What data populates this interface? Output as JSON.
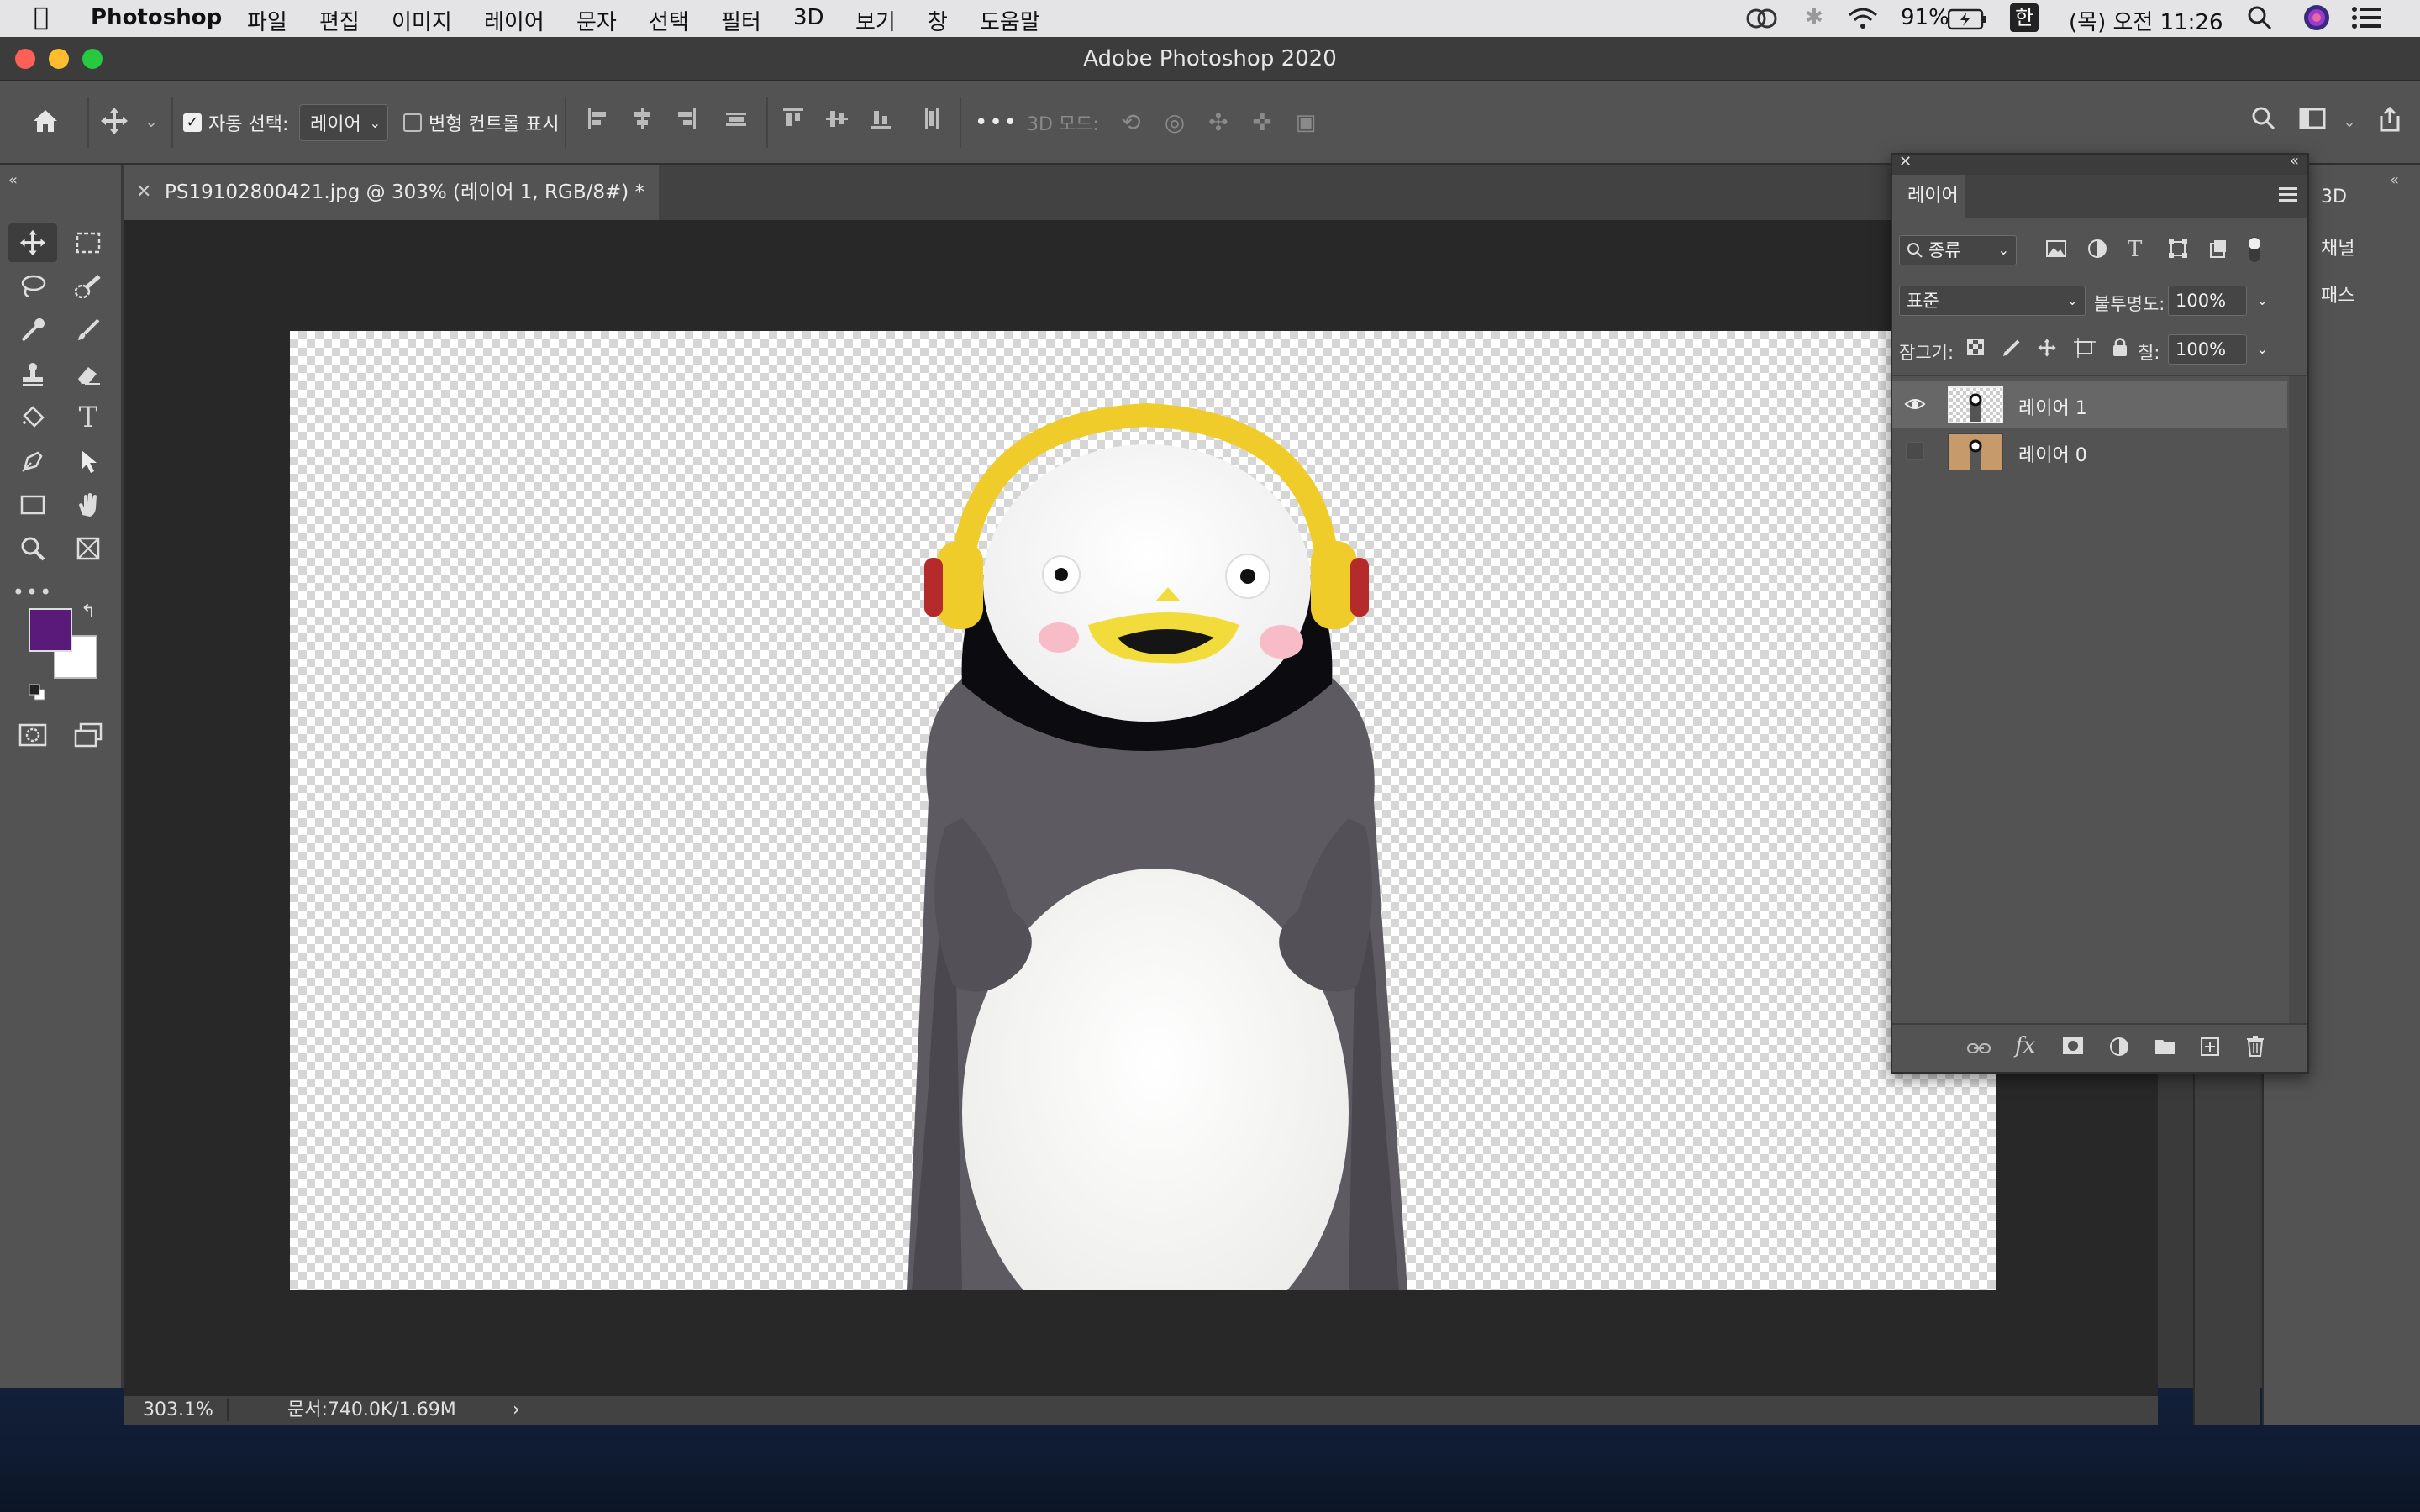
{
  "menubar": {
    "app_name": "Photoshop",
    "items": [
      "파일",
      "편집",
      "이미지",
      "레이어",
      "문자",
      "선택",
      "필터",
      "3D",
      "보기",
      "창",
      "도움말"
    ],
    "battery": "91%",
    "input_source": "한",
    "clock": "(목) 오전 11:26"
  },
  "window": {
    "title": "Adobe Photoshop 2020"
  },
  "options_bar": {
    "auto_select_label": "자동 선택:",
    "auto_select_checked": true,
    "auto_select_target": "레이어",
    "transform_controls_label": "변형 컨트롤 표시",
    "transform_controls_checked": false,
    "more": "•••",
    "mode_3d_label": "3D 모드:"
  },
  "document": {
    "tab_title": "PS19102800421.jpg @ 303% (레이어 1, RGB/8#) *",
    "zoom": "303.1%",
    "doc_info": "문서:740.0K/1.69M",
    "status_arrow": "›"
  },
  "colors": {
    "foreground": "#5a1a7a",
    "background": "#ffffff",
    "panel": "#535353",
    "selected_layer": "#676767"
  },
  "layers_panel": {
    "tab": "레이어",
    "filter_kind": "종류",
    "blend_mode": "표준",
    "opacity_label": "불투명도:",
    "opacity_value": "100%",
    "lock_label": "잠그기:",
    "fill_label": "칠:",
    "fill_value": "100%",
    "layers": [
      {
        "name": "레이어 1",
        "visible": true,
        "selected": true
      },
      {
        "name": "레이어 0",
        "visible": false,
        "selected": false
      }
    ],
    "footer_fx": "fx"
  },
  "dock": {
    "items": [
      "3D",
      "채널",
      "패스"
    ]
  },
  "icons": {
    "toolbar": [
      "move-icon",
      "marquee-icon",
      "lasso-icon",
      "quick-select-icon",
      "eyedropper-icon",
      "brush-icon",
      "stamp-icon",
      "eraser-icon",
      "paint-bucket-icon",
      "type-icon",
      "pen-icon",
      "path-select-icon",
      "rectangle-icon",
      "hand-icon",
      "zoom-icon",
      "frame-icon",
      "more-tools-icon"
    ]
  }
}
